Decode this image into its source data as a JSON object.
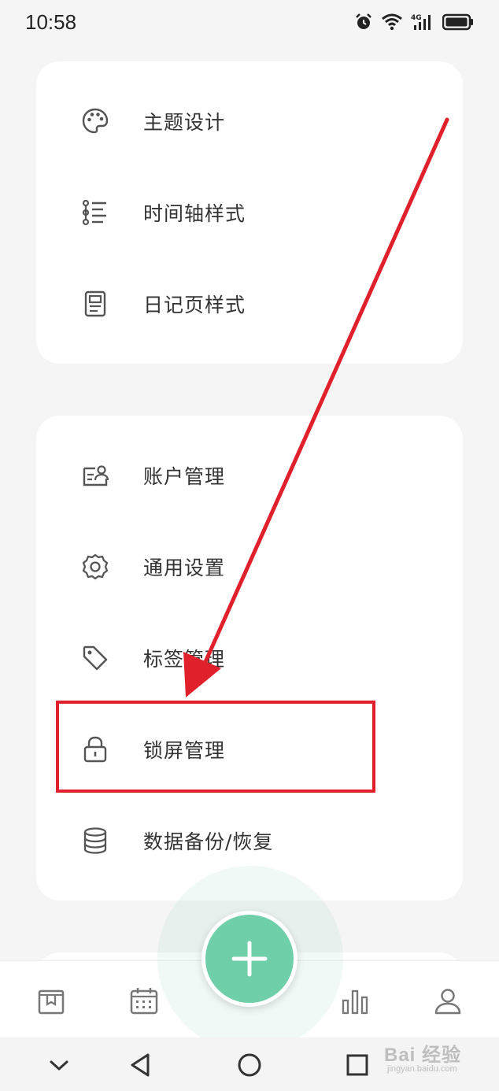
{
  "status_bar": {
    "time": "10:58",
    "icons": [
      "alarm-icon",
      "wifi-icon",
      "4g-signal-icon",
      "battery-icon"
    ],
    "network_label": "4G"
  },
  "settings_group_1": {
    "items": [
      {
        "label": "主题设计",
        "icon": "palette-icon"
      },
      {
        "label": "时间轴样式",
        "icon": "timeline-list-icon"
      },
      {
        "label": "日记页样式",
        "icon": "document-page-icon"
      }
    ]
  },
  "settings_group_2": {
    "items": [
      {
        "label": "账户管理",
        "icon": "account-card-icon"
      },
      {
        "label": "通用设置",
        "icon": "gear-icon"
      },
      {
        "label": "标签管理",
        "icon": "tag-icon"
      },
      {
        "label": "锁屏管理",
        "icon": "lock-icon"
      },
      {
        "label": "数据备份/恢复",
        "icon": "database-icon"
      }
    ]
  },
  "bottom_nav": {
    "items": [
      "diary-book-icon",
      "calendar-icon",
      "add-icon",
      "statistics-icon",
      "profile-icon"
    ],
    "fab_symbol": "+"
  },
  "system_nav": {
    "buttons": [
      "collapse-chevron-icon",
      "back-icon",
      "home-icon",
      "recents-icon"
    ]
  },
  "watermark": {
    "brand": "Bai 经验",
    "subtitle": "jingyan.baidu.com"
  },
  "colors": {
    "background": "#f5f5f5",
    "card": "#ffffff",
    "text": "#333333",
    "icon": "#555555",
    "accent": "#6fcfa8",
    "annotation": "#e0202a"
  }
}
